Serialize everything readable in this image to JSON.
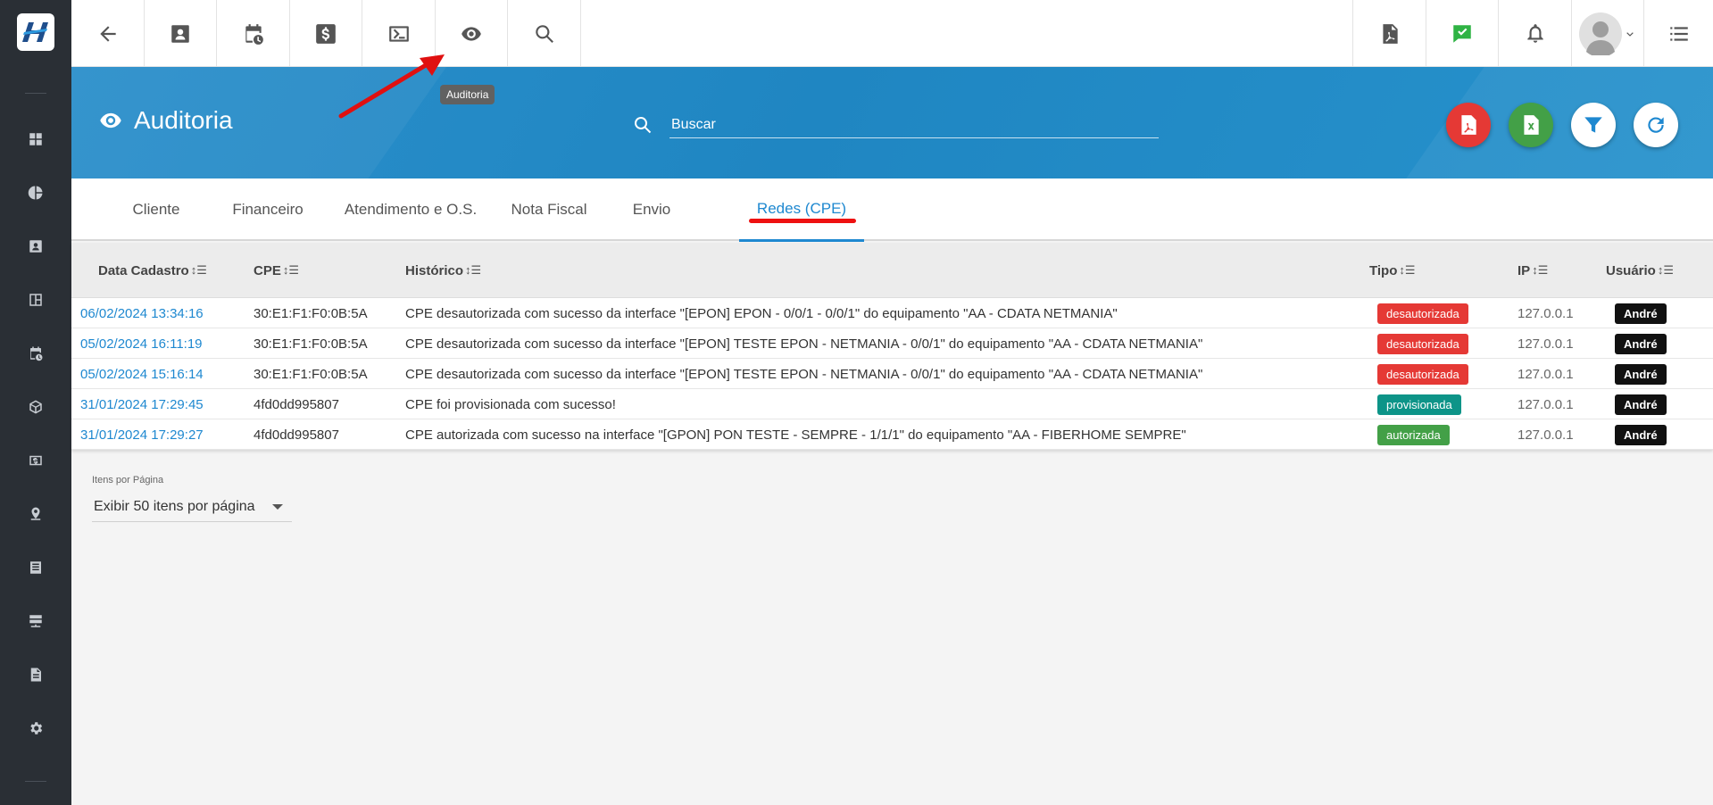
{
  "sidebar": {
    "items": [
      {
        "icon": "dashboard-icon"
      },
      {
        "icon": "pie-chart-icon"
      },
      {
        "icon": "contact-card-icon"
      },
      {
        "icon": "board-icon"
      },
      {
        "icon": "calendar-clock-icon"
      },
      {
        "icon": "box-icon"
      },
      {
        "icon": "money-icon"
      },
      {
        "icon": "map-pin-icon"
      },
      {
        "icon": "list-icon"
      },
      {
        "icon": "server-icon"
      },
      {
        "icon": "document-icon"
      },
      {
        "icon": "gear-icon"
      }
    ]
  },
  "topbar": {
    "tooltip": "Auditoria"
  },
  "header": {
    "title": "Auditoria",
    "search_placeholder": "Buscar"
  },
  "tabs": [
    {
      "label": "Cliente"
    },
    {
      "label": "Financeiro"
    },
    {
      "label": "Atendimento e O.S."
    },
    {
      "label": "Nota Fiscal"
    },
    {
      "label": "Envio"
    },
    {
      "label": "Redes (CPE)"
    }
  ],
  "table": {
    "columns": [
      "Data Cadastro",
      "CPE",
      "Histórico",
      "Tipo",
      "IP",
      "Usuário"
    ],
    "rows": [
      {
        "date": "06/02/2024 13:34:16",
        "cpe": "30:E1:F1:F0:0B:5A",
        "history": "CPE desautorizada com sucesso da interface \"[EPON] EPON - 0/0/1 - 0/0/1\" do equipamento \"AA - CDATA NETMANIA\"",
        "type": "desautorizada",
        "type_color": "#e53935",
        "ip": "127.0.0.1",
        "user": "André"
      },
      {
        "date": "05/02/2024 16:11:19",
        "cpe": "30:E1:F1:F0:0B:5A",
        "history": "CPE desautorizada com sucesso da interface \"[EPON] TESTE EPON - NETMANIA - 0/0/1\" do equipamento \"AA - CDATA NETMANIA\"",
        "type": "desautorizada",
        "type_color": "#e53935",
        "ip": "127.0.0.1",
        "user": "André"
      },
      {
        "date": "05/02/2024 15:16:14",
        "cpe": "30:E1:F1:F0:0B:5A",
        "history": "CPE desautorizada com sucesso da interface \"[EPON] TESTE EPON - NETMANIA - 0/0/1\" do equipamento \"AA - CDATA NETMANIA\"",
        "type": "desautorizada",
        "type_color": "#e53935",
        "ip": "127.0.0.1",
        "user": "André"
      },
      {
        "date": "31/01/2024 17:29:45",
        "cpe": "4fd0dd995807",
        "history": "CPE foi provisionada com sucesso!",
        "type": "provisionada",
        "type_color": "#0d9488",
        "ip": "127.0.0.1",
        "user": "André"
      },
      {
        "date": "31/01/2024 17:29:27",
        "cpe": "4fd0dd995807",
        "history": "CPE autorizada com sucesso na interface \"[GPON] PON TESTE - SEMPRE - 1/1/1\" do equipamento \"AA - FIBERHOME SEMPRE\"",
        "type": "autorizada",
        "type_color": "#43a047",
        "ip": "127.0.0.1",
        "user": "André"
      }
    ]
  },
  "pagination": {
    "label": "Itens por Página",
    "value": "Exibir 50 itens por página"
  },
  "colors": {
    "accent": "#1e88d0",
    "sidebar": "#2a2f35",
    "fab_pdf": "#e53935",
    "fab_excel": "#43a047"
  }
}
